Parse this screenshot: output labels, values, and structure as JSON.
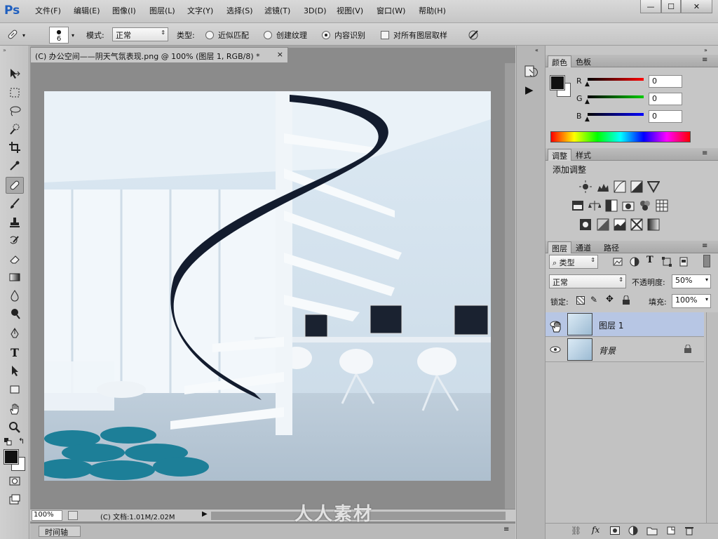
{
  "app": {
    "logo": "Ps",
    "window_buttons": [
      "—",
      "☐",
      "✕"
    ]
  },
  "menu": [
    "文件(F)",
    "编辑(E)",
    "图像(I)",
    "图层(L)",
    "文字(Y)",
    "选择(S)",
    "滤镜(T)",
    "3D(D)",
    "视图(V)",
    "窗口(W)",
    "帮助(H)"
  ],
  "options": {
    "brush_size": "6",
    "mode_label": "模式:",
    "mode_value": "正常",
    "type_label": "类型:",
    "radio_1": "近似匹配",
    "radio_2": "创建纹理",
    "radio_3": "内容识别",
    "sample_all": "对所有图层取样"
  },
  "document": {
    "tab_title": "(C) 办公空间——阴天气氛表现.png @ 100% (图层 1, RGB/8) *",
    "tab_close": "×"
  },
  "status": {
    "zoom": "100%",
    "doc_info": "(C) 文档:1.01M/2.02M"
  },
  "timeline": {
    "label": "时间轴"
  },
  "watermark": "人人素材",
  "color_panel": {
    "tabs": [
      "颜色",
      "色板"
    ],
    "r_label": "R",
    "g_label": "G",
    "b_label": "B",
    "r_value": "0",
    "g_value": "0",
    "b_value": "0"
  },
  "adjust_panel": {
    "tabs": [
      "调整",
      "样式"
    ],
    "title": "添加调整"
  },
  "layers_panel": {
    "tabs": [
      "图层",
      "通道",
      "路径"
    ],
    "filter_kind": "类型",
    "blend_mode": "正常",
    "opacity_label": "不透明度:",
    "opacity_value": "50%",
    "lock_label": "锁定:",
    "fill_label": "填充:",
    "fill_value": "100%",
    "layers": [
      {
        "name": "图层 1",
        "selected": true
      },
      {
        "name": "背景",
        "selected": false
      }
    ]
  },
  "colors": {
    "accent": "#1f5fbf",
    "layer_selected": "#b7c6e4"
  }
}
